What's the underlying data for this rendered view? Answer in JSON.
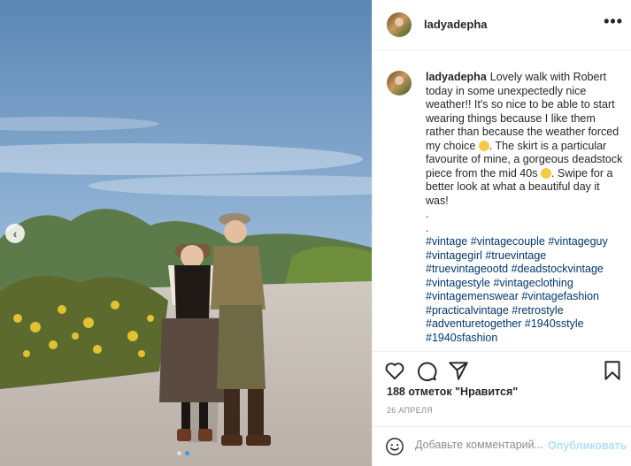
{
  "header": {
    "username": "ladyadepha",
    "more_label": "•••"
  },
  "caption": {
    "username": "ladyadepha",
    "part1": "Lovely walk with Robert today in some unexpectedly nice weather!! It's so nice to be able to start wearing things because I like them rather than because the weather forced my choice",
    "part2": ". The skirt is a particular favourite of mine, a gorgeous deadstock piece from the mid 40s",
    "part3": ". Swipe for a better look at what a beautiful day it was!",
    "dot1": ".",
    "dot2": ".",
    "hashtags": [
      "#vintage",
      "#vintagecouple",
      "#vintageguy",
      "#vintagegirl",
      "#truevintage",
      "#truevintageootd",
      "#deadstockvintage",
      "#vintagestyle",
      "#vintageclothing",
      "#vintagemenswear",
      "#vintagefashion",
      "#practicalvintage",
      "#retrostyle",
      "#adventuretogether",
      "#1940sstyle",
      "#1940sfashion"
    ]
  },
  "likes": "188 отметок \"Нравится\"",
  "date": "26 АПРЕЛЯ",
  "comment": {
    "placeholder": "Добавьте комментарий...",
    "publish": "Опубликовать"
  },
  "carousel": {
    "prev_label": "‹",
    "slides": 2,
    "active": 1
  },
  "icons": [
    "heart-icon",
    "comment-icon",
    "share-icon",
    "bookmark-icon",
    "emoji-icon",
    "chevron-left-icon"
  ],
  "colors": {
    "link": "#00376b",
    "accent": "#3897f0",
    "publish_disabled": "#b2dffc",
    "meta": "#8e8e8e"
  }
}
